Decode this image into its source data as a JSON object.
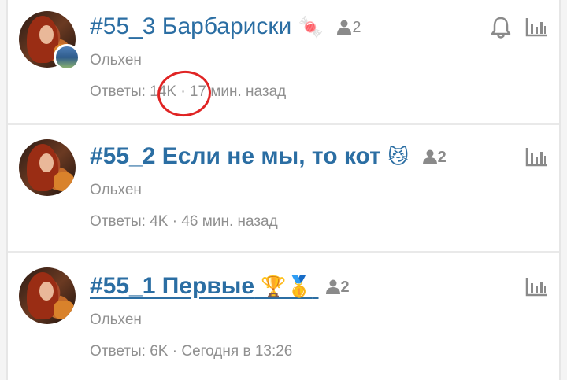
{
  "threads": [
    {
      "title": "#55_3 Барбариски",
      "emoji": "🍬",
      "members": "2",
      "author": "Ольхен",
      "replies_label": "Ответы:",
      "replies_count": "14K",
      "separator": "·",
      "time": "17 мин. назад",
      "has_bell": true
    },
    {
      "title": "#55_2 Если не мы, то кот",
      "emoji": "😼",
      "members": "2",
      "author": "Ольхен",
      "replies_label": "Ответы:",
      "replies_count": "4K",
      "separator": "·",
      "time": "46 мин. назад",
      "has_bell": false
    },
    {
      "title": "#55_1 Первые",
      "emoji": "🏆🥇",
      "members": "2",
      "author": "Ольхен",
      "replies_label": "Ответы:",
      "replies_count": "6K",
      "separator": "·",
      "time": "Сегодня в 13:26",
      "has_bell": false
    }
  ],
  "colors": {
    "title": "#2b6ea3",
    "muted": "#909090",
    "annotation": "#e02424"
  }
}
